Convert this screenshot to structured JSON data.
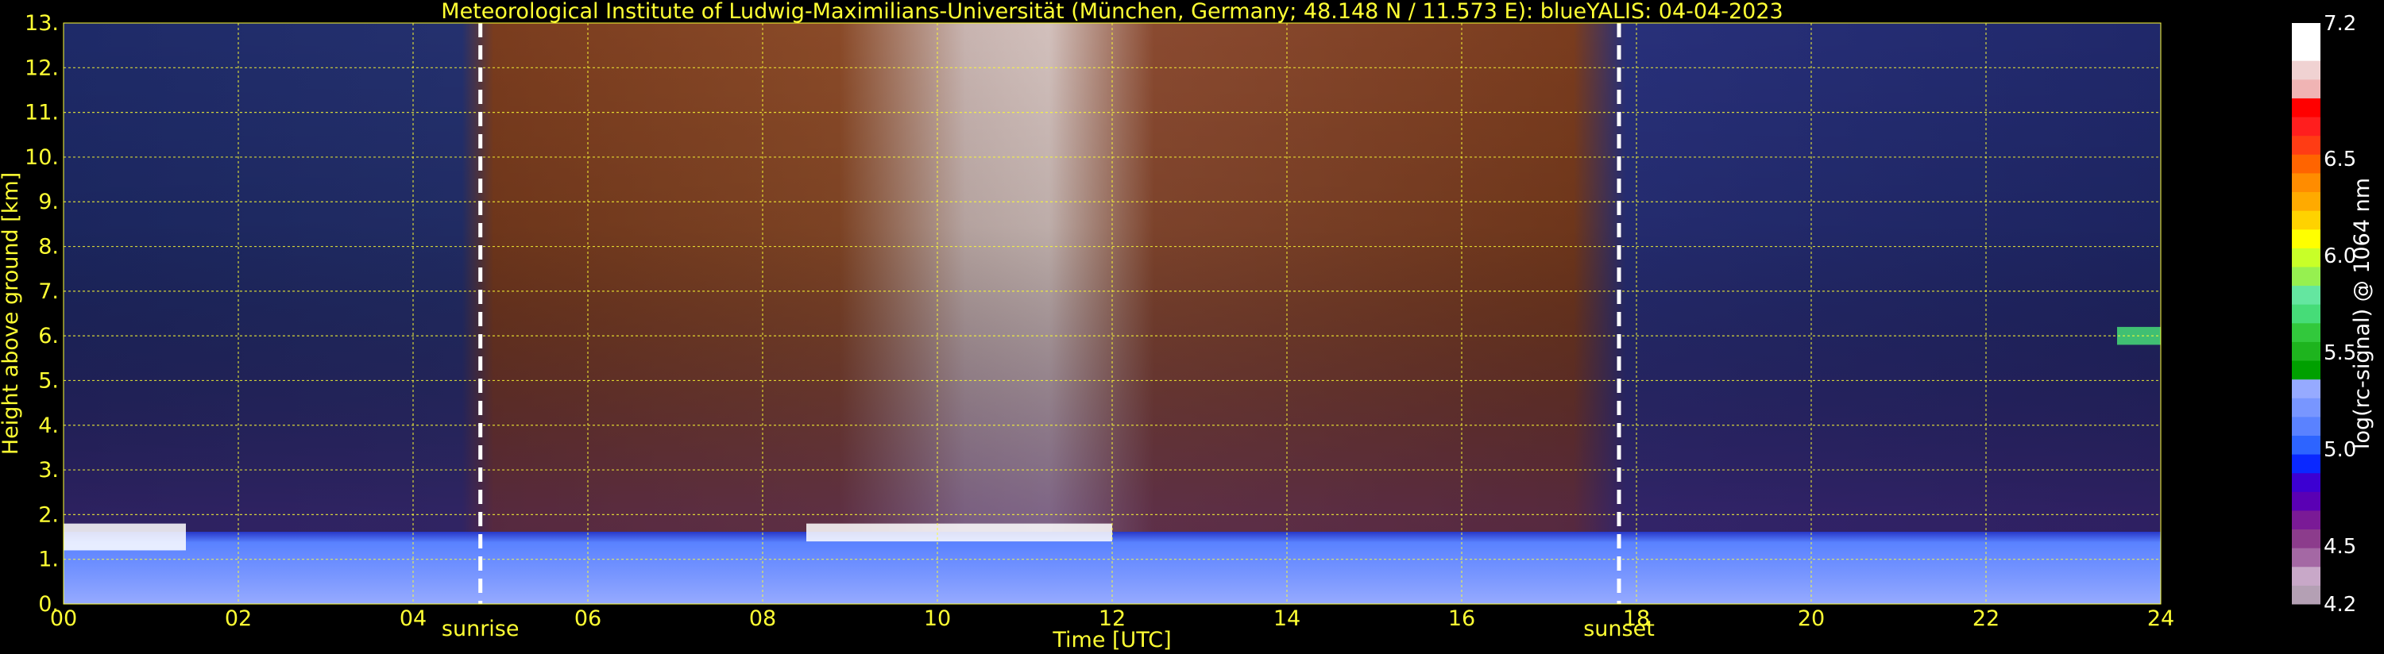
{
  "chart_data": {
    "type": "heatmap",
    "title": "Meteorological Institute of Ludwig-Maximilians-Universität (München, Germany; 48.148 N / 11.573 E):    blueYALIS: 04-04-2023",
    "xlabel": "Time [UTC]",
    "ylabel": "Height above ground [km]",
    "xlim": [
      0,
      24
    ],
    "ylim": [
      0,
      13
    ],
    "x_ticks": [
      "00",
      "02",
      "04",
      "06",
      "08",
      "10",
      "12",
      "14",
      "16",
      "18",
      "20",
      "22",
      "24"
    ],
    "x_tick_values": [
      0,
      2,
      4,
      6,
      8,
      10,
      12,
      14,
      16,
      18,
      20,
      22,
      24
    ],
    "y_ticks": [
      "0.",
      "1.",
      "2.",
      "3.",
      "4.",
      "5.",
      "6.",
      "7.",
      "8.",
      "9.",
      "10.",
      "11.",
      "12.",
      "13."
    ],
    "y_tick_values": [
      0,
      1,
      2,
      3,
      4,
      5,
      6,
      7,
      8,
      9,
      10,
      11,
      12,
      13
    ],
    "grid": true,
    "annotations": [
      {
        "label": "sunrise",
        "x": 4.77
      },
      {
        "label": "sunset",
        "x": 17.8
      }
    ],
    "colorbar": {
      "label": "log(rc-signal) @ 1064 nm",
      "range": [
        4.2,
        7.2
      ],
      "tick_labels": [
        "7.2",
        "6.5",
        "6.0",
        "5.5",
        "5.0",
        "4.5",
        "4.2"
      ],
      "tick_values": [
        7.2,
        6.5,
        6.0,
        5.5,
        5.0,
        4.5,
        4.2
      ],
      "colors": [
        "#b4a0b4",
        "#c8a8c8",
        "#a468a4",
        "#8c3c8c",
        "#7a1a96",
        "#5a00b4",
        "#3c00d2",
        "#0a28ff",
        "#2d64ff",
        "#5a82ff",
        "#7896ff",
        "#96aaff",
        "#00a000",
        "#1eb41e",
        "#32c83c",
        "#46dc78",
        "#64e6a0",
        "#96f050",
        "#c8ff28",
        "#ffff00",
        "#ffd200",
        "#ffaa00",
        "#ff8c00",
        "#ff6400",
        "#ff3c14",
        "#ff1e1e",
        "#ff0000",
        "#f0b4b4",
        "#f0d2d2",
        "#ffffff",
        "#ffffff"
      ]
    },
    "features": [
      {
        "kind": "aerosol_boundary_layer",
        "x_range": [
          0,
          24
        ],
        "height_km": [
          0,
          1.6
        ]
      },
      {
        "kind": "cloud_at_bl_top",
        "x_range": [
          8.5,
          12
        ],
        "height_km": [
          1.4,
          1.8
        ]
      },
      {
        "kind": "cloud_layer",
        "x_range": [
          23.5,
          24
        ],
        "height_km": [
          5.8,
          6.2
        ]
      },
      {
        "kind": "low_cloud",
        "x_range": [
          0,
          1.4
        ],
        "height_km": [
          1.2,
          1.8
        ]
      }
    ]
  }
}
